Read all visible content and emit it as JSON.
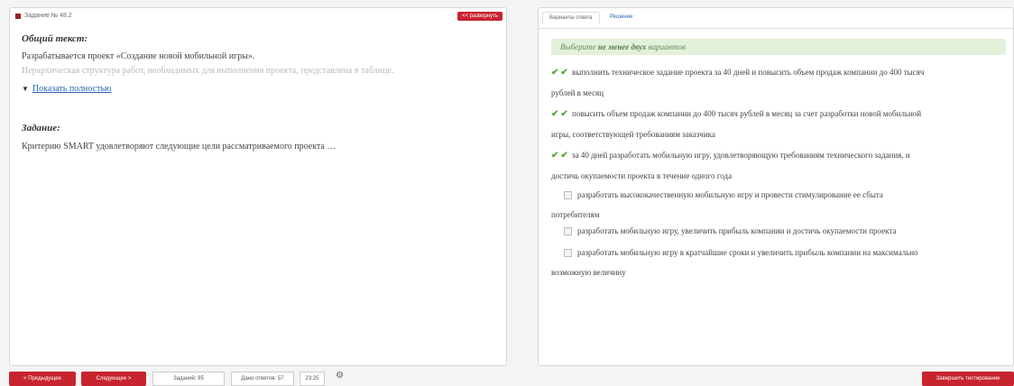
{
  "left": {
    "task_label": "Задание № 48.2",
    "expand_label": "<< развернуть",
    "general_title": "Общий текст:",
    "general_line1": "Разрабатывается проект «Создание новой мобильной игры».",
    "general_line2": "Иерархическая структура работ, необходимых для выполнения проекта, представлена в таблице.",
    "show_more_icon": "▼",
    "show_more_label": "Показать полностью",
    "task_title": "Задание:",
    "task_text": "Критерию SMART удовлетворяют следующие цели рассматриваемого проекта …"
  },
  "right": {
    "tab_options": "Варианты ответа",
    "tab_solution": "Решение",
    "hint_prefix": "Выберите ",
    "hint_bold": "не менее двух",
    "hint_suffix": " вариантов",
    "options": [
      {
        "checked": true,
        "line1": "выполнить техническое задание проекта за 40 дней и повысить объем продаж компании до 400 тысяч",
        "line2": "рублей в месяц"
      },
      {
        "checked": true,
        "line1": "повысить объем продаж компании до 400 тысяч рублей в месяц за счет разработки новой мобильной",
        "line2": "игры, соответствующей требованиям заказчика"
      },
      {
        "checked": true,
        "line1": "за 40 дней разработать мобильную игру, удовлетворяющую требованиям технического задания, и",
        "line2": "достичь окупаемости проекта в течение одного года"
      },
      {
        "checked": false,
        "line1": "разработать высококачественную мобильную игру и провести стимулирование ее сбыта",
        "line2": "потребителям"
      },
      {
        "checked": false,
        "line1": "разработать мобильную игру, увеличить прибыль компании и достичь окупаемости проекта",
        "line2": ""
      },
      {
        "checked": false,
        "line1": "разработать мобильную игру в кратчайшие сроки и увеличить прибыль компании на максимально",
        "line2": "возможную величину"
      }
    ]
  },
  "bottom": {
    "prev_label": "< Предыдущее",
    "next_label": "Следующее >",
    "tasks_label": "Заданий: 85",
    "answers_label": "Дано ответов: 57",
    "timer": "23:25",
    "gear_icon": "⚙",
    "finish_label": "Завершить тестирование"
  },
  "check_icon": "✔"
}
